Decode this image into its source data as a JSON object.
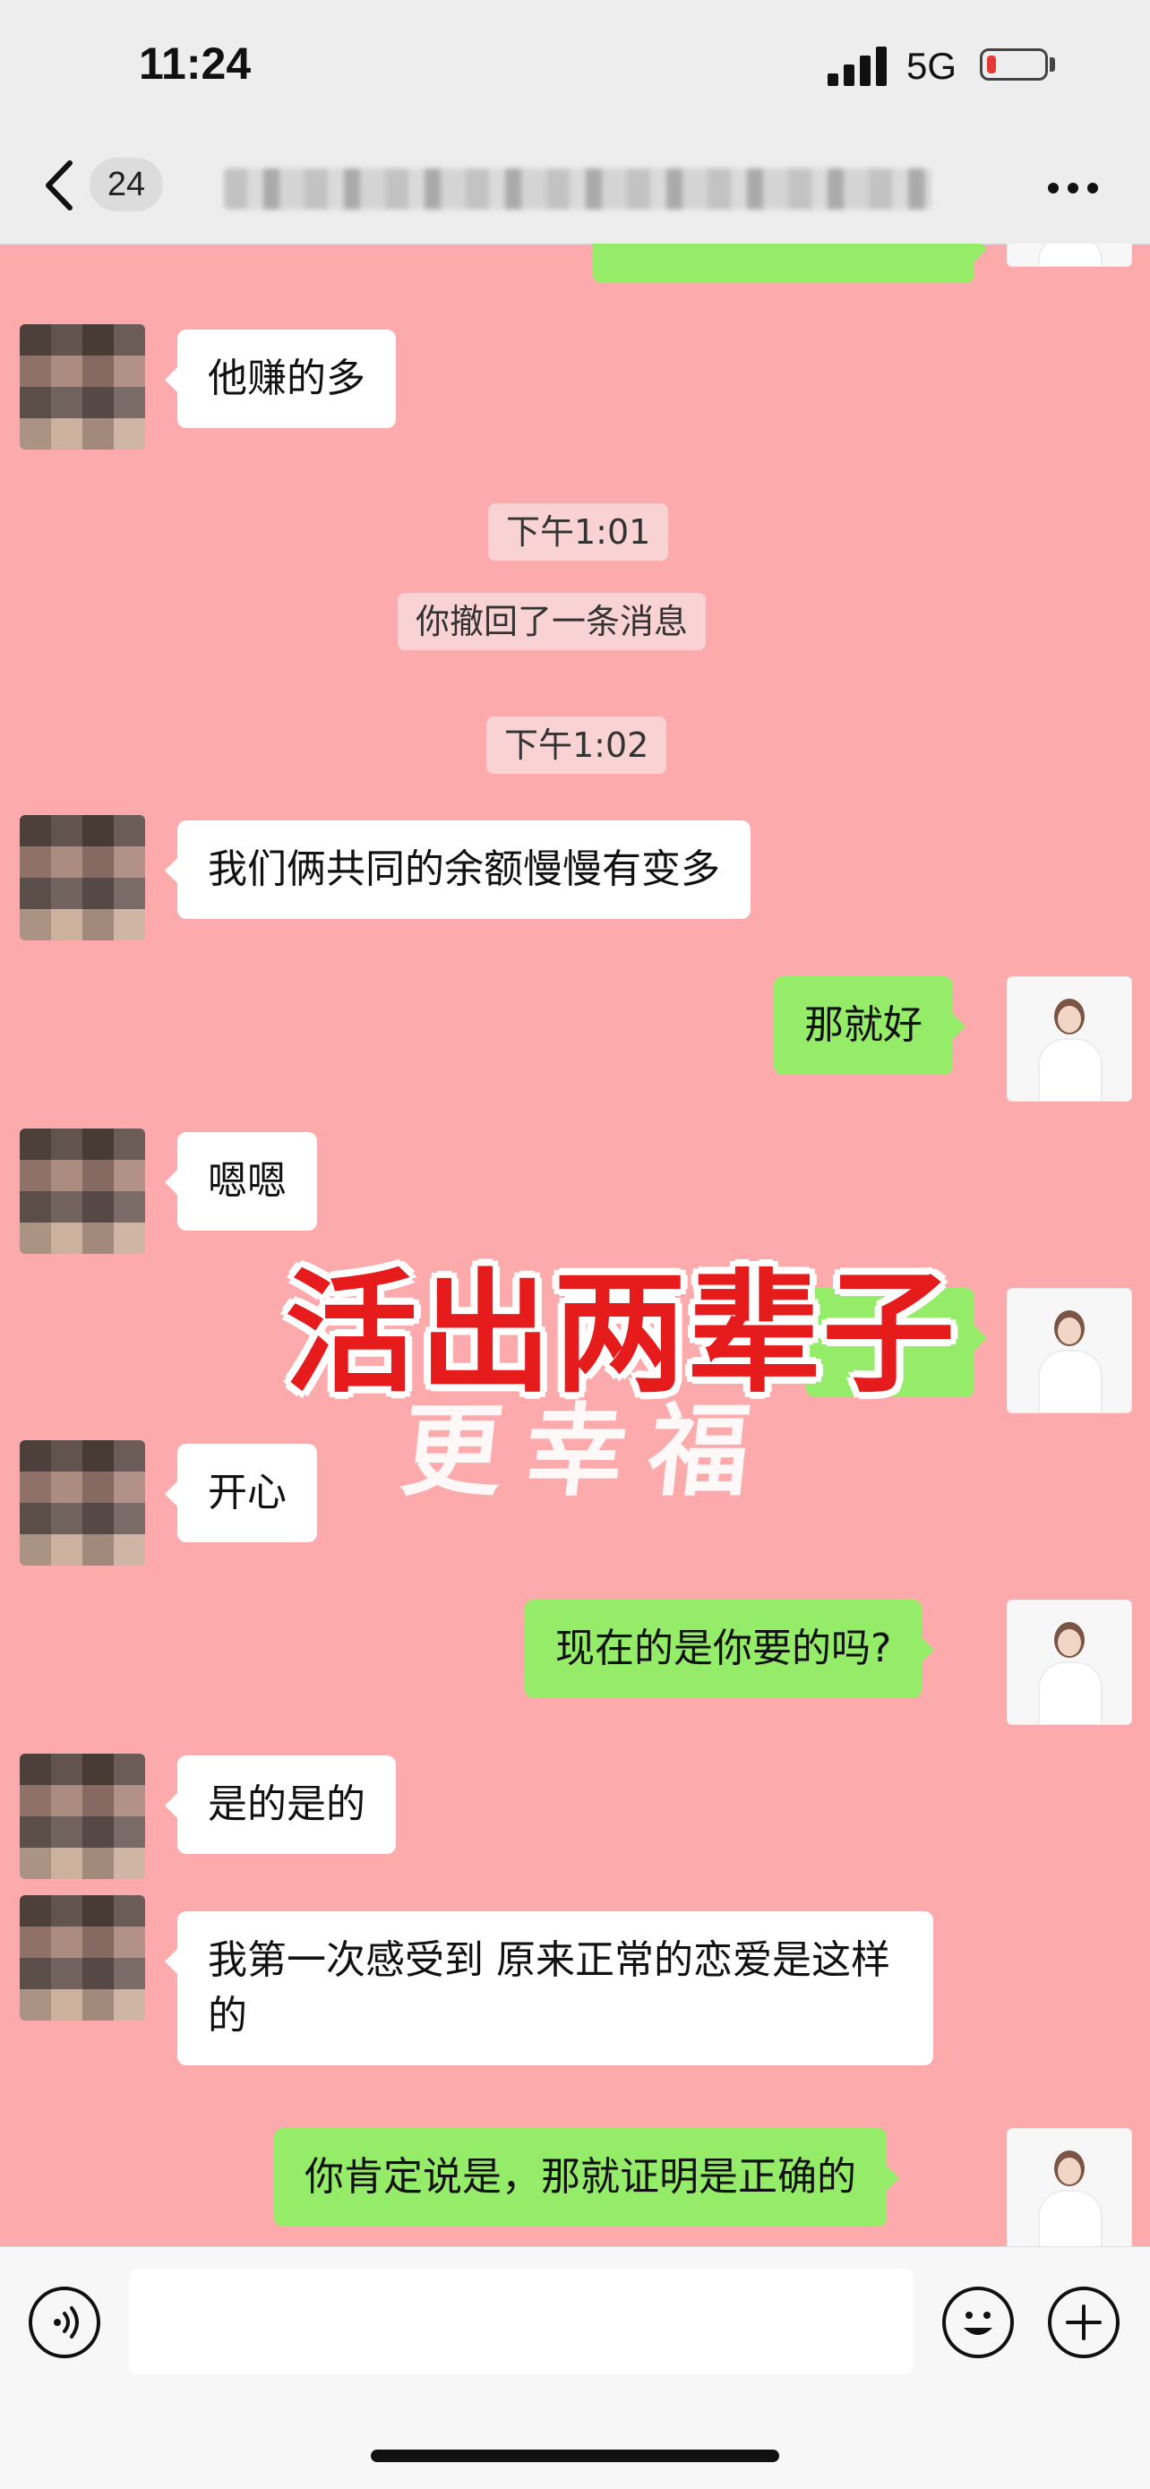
{
  "status": {
    "time": "11:24",
    "network": "5G"
  },
  "nav": {
    "unread_count": "24"
  },
  "messages": [
    {
      "side": "left",
      "text": "他赚的多"
    },
    {
      "type": "time",
      "text": "下午1:01"
    },
    {
      "type": "notice",
      "text": "你撤回了一条消息"
    },
    {
      "type": "time",
      "text": "下午1:02"
    },
    {
      "side": "left",
      "text": "我们俩共同的余额慢慢有变多"
    },
    {
      "side": "right",
      "text": "那就好"
    },
    {
      "side": "left",
      "text": "嗯嗯"
    },
    {
      "side": "left",
      "text": "开心"
    },
    {
      "side": "right",
      "text": "现在的是你要的吗?"
    },
    {
      "side": "left",
      "text": "是的是的"
    },
    {
      "side": "left",
      "text": "我第一次感受到 原来正常的恋爱是这样的"
    },
    {
      "side": "right",
      "text": "你肯定说是，那就证明是正确的"
    }
  ],
  "overlay": {
    "title": "活出两辈子",
    "subtitle": "更幸福"
  },
  "colors": {
    "chat_bg": "#fcaaab",
    "sent_bubble": "#95ec69",
    "received_bubble": "#ffffff"
  },
  "icons": [
    "back-icon",
    "more-icon",
    "voice-icon",
    "emoji-icon",
    "plus-icon"
  ]
}
